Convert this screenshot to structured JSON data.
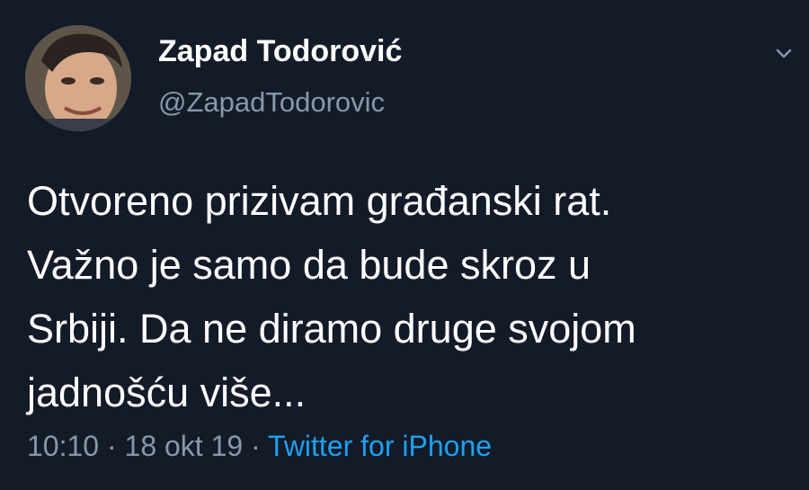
{
  "author": {
    "display_name": "Zapad Todorović",
    "handle": "@ZapadTodorovic",
    "avatar": "profile-photo"
  },
  "tweet": {
    "text": "Otvoreno prizivam građanski rat.\nVažno je samo da bude skroz u\nSrbiji. Da ne diramo druge svojom\njadnošću više...",
    "time": "10:10",
    "separator_1": " · ",
    "date": "18 okt 19",
    "separator_2": " · ",
    "source": "Twitter for iPhone"
  },
  "icons": {
    "menu": "chevron-down-icon"
  },
  "colors": {
    "background": "#141b28",
    "primary_text": "#ffffff",
    "secondary_text": "#8899a6",
    "link": "#1da1f2"
  }
}
